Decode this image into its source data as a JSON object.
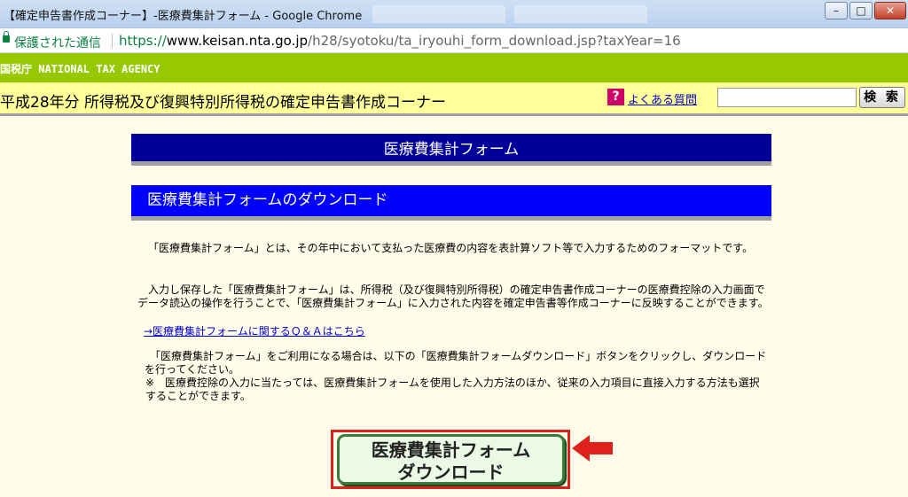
{
  "window": {
    "title": "【確定申告書作成コーナー】-医療費集計フォーム - Google Chrome"
  },
  "addressbar": {
    "secure_label": "保護された通信",
    "url_scheme": "https://",
    "url_host": "www.keisan.nta.go.jp",
    "url_path": "/h28/syotoku/ta_iryouhi_form_download.jsp?taxYear=16"
  },
  "agency_bar": {
    "label": "国税庁  NATIONAL TAX AGENCY"
  },
  "header": {
    "title": "平成28年分 所得税及び復興特別所得税の確定申告書作成コーナー",
    "help_icon": "?",
    "faq_link": "よくある質問",
    "search_value": "",
    "search_button": "検 索"
  },
  "main": {
    "form_title": "医療費集計フォーム",
    "section_title": "医療費集計フォームのダウンロード",
    "para1": "「医療費集計フォーム」とは、その年中において支払った医療費の内容を表計算ソフト等で入力するためのフォーマットです。",
    "para2": "入力し保存した「医療費集計フォーム」は、所得税（及び復興特別所得税）の確定申告書作成コーナーの医療費控除の入力画面でデータ読込の操作を行うことで、「医療費集計フォーム」に入力された内容を確定申告書等作成コーナーに反映することができます。",
    "qa_link": "→医療費集計フォームに関するＱ＆Ａはこちら",
    "para3": "「医療費集計フォーム」をご利用になる場合は、以下の「医療費集計フォームダウンロード」ボタンをクリックし、ダウンロードを行ってください。",
    "note": "※　医療費控除の入力に当たっては、医療費集計フォームを使用した入力方法のほか、従来の入力項目に直接入力する方法も選択することができます。",
    "download_line1": "医療費集計フォーム",
    "download_line2": "ダウンロード"
  },
  "colors": {
    "agency_green": "#97c802",
    "header_yellow": "#ffff99",
    "form_banner": "#000099",
    "section_header": "#0000ff",
    "highlight_red": "#e0201c"
  }
}
